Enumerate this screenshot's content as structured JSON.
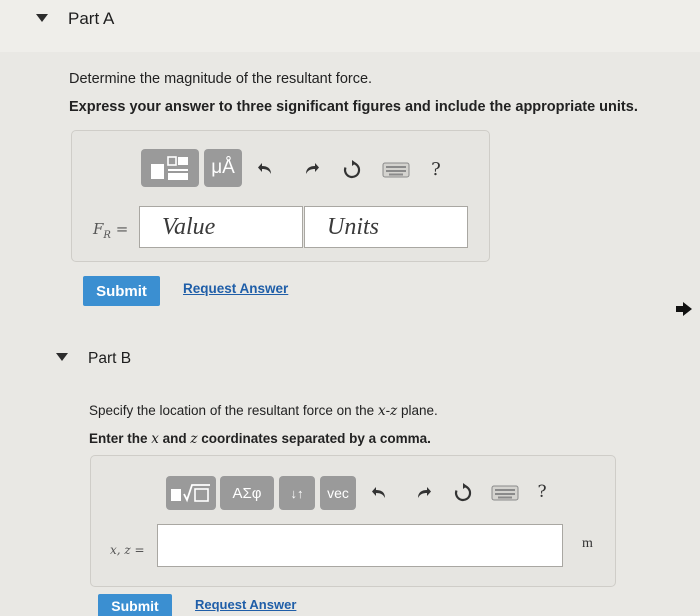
{
  "part_a": {
    "title": "Part A",
    "question": "Determine the magnitude of the resultant force.",
    "instruction": "Express your answer to three significant figures and include the appropriate units.",
    "toolbar": {
      "units_symbol": "μÅ",
      "help": "?"
    },
    "label": "F",
    "label_sub": "R",
    "label_eq": " =",
    "value_placeholder": "Value",
    "units_placeholder": "Units",
    "submit_label": "Submit",
    "request_label": "Request Answer"
  },
  "part_b": {
    "title": "Part B",
    "question_pre": "Specify the location of the resultant force on the ",
    "question_x": "x",
    "question_mid": "-",
    "question_z": "z",
    "question_post": " plane.",
    "instruction_pre": "Enter the ",
    "instruction_x": "x",
    "instruction_mid": " and ",
    "instruction_z": "z",
    "instruction_post": " coordinates separated by a comma.",
    "toolbar": {
      "greek_label": "ΑΣφ",
      "swap_label": "↓↑",
      "vec_label": "vec",
      "help": "?"
    },
    "label": "x, z =",
    "unit": "m",
    "submit_label": "Submit",
    "request_label": "Request Answer"
  }
}
